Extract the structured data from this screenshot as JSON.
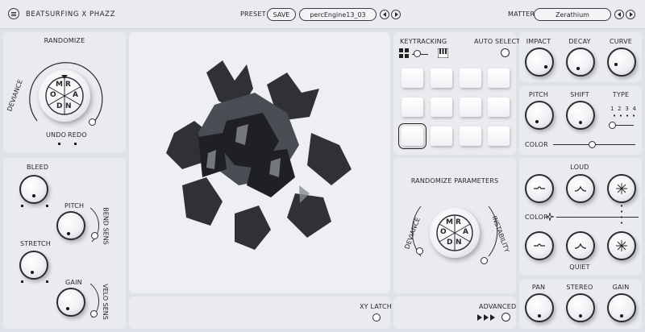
{
  "header": {
    "app_title": "BEATSURFING X PHAZZ",
    "preset_label": "PRESET",
    "save_label": "SAVE",
    "preset_name": "percEngine13_03",
    "matter_label": "MATTER",
    "matter_name": "Zerathium"
  },
  "randomize": {
    "title": "RANDOMIZE",
    "deviance_label": "DEVIANCE",
    "wheel_letters": [
      "R",
      "A",
      "N",
      "D",
      "O",
      "M"
    ],
    "undo_label": "UNDO",
    "redo_label": "REDO"
  },
  "left_lower": {
    "bleed_label": "BLEED",
    "pitch_label": "PITCH",
    "bend_sens_label": "BEND SENS",
    "stretch_label": "STRETCH",
    "gain_label": "GAIN",
    "velo_sens_label": "VELO SENS"
  },
  "center": {
    "xy_latch_label": "XY LATCH"
  },
  "keytracking": {
    "title": "KEYTRACKING",
    "auto_select_label": "AUTO SELECT",
    "pads": 12,
    "selected_pad": 9
  },
  "randomize_params": {
    "title": "RANDOMIZE PARAMETERS",
    "deviance_label": "DEVIANCE",
    "instability_label": "INSTABILITY",
    "advanced_label": "ADVANCED"
  },
  "envelope": {
    "impact_label": "IMPACT",
    "decay_label": "DECAY",
    "curve_label": "CURVE"
  },
  "tone": {
    "pitch_label": "PITCH",
    "shift_label": "SHIFT",
    "type_label": "TYPE",
    "type_options": [
      "1",
      "2",
      "3",
      "4"
    ],
    "color_label": "COLOR"
  },
  "dynamics": {
    "loud_label": "LOUD",
    "color_label": "COLOR",
    "quiet_label": "QUIET"
  },
  "output": {
    "pan_label": "PAN",
    "stereo_label": "STEREO",
    "gain_label": "GAIN"
  },
  "colors": {
    "background": "#dfe2e8",
    "panel": "#e9ebef",
    "ink": "#25272b"
  }
}
